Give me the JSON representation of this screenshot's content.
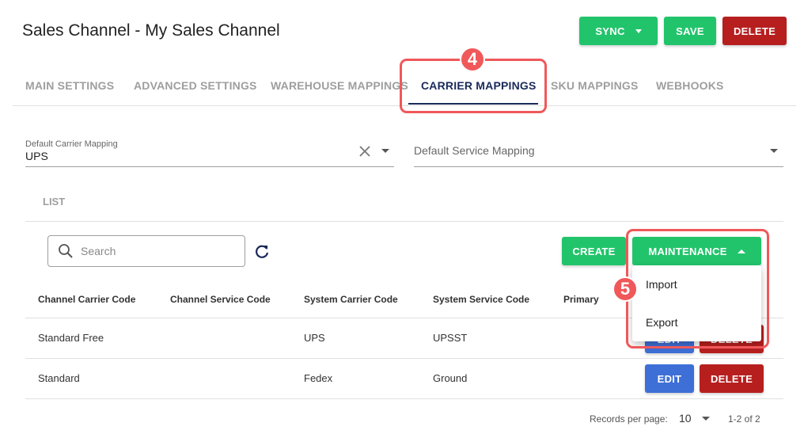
{
  "header": {
    "title": "Sales Channel - My Sales Channel",
    "sync_label": "SYNC",
    "save_label": "SAVE",
    "delete_label": "DELETE"
  },
  "tabs": [
    {
      "label": "MAIN SETTINGS"
    },
    {
      "label": "ADVANCED SETTINGS"
    },
    {
      "label": "WAREHOUSE MAPPINGS"
    },
    {
      "label": "CARRIER MAPPINGS",
      "active": true
    },
    {
      "label": "SKU MAPPINGS"
    },
    {
      "label": "WEBHOOKS"
    }
  ],
  "annotations": {
    "step_tab": "4",
    "step_menu": "5"
  },
  "default_carrier": {
    "label": "Default Carrier Mapping",
    "value": "UPS"
  },
  "default_service": {
    "placeholder": "Default Service Mapping"
  },
  "list": {
    "label": "LIST",
    "search_placeholder": "Search",
    "create_label": "CREATE",
    "maintenance_label": "MAINTENANCE",
    "menu": [
      "Import",
      "Export"
    ]
  },
  "table": {
    "columns": [
      "Channel Carrier Code",
      "Channel Service Code",
      "System Carrier Code",
      "System Service Code",
      "Primary"
    ],
    "rows": [
      {
        "channel_carrier": "Standard Free",
        "channel_service": "",
        "system_carrier": "UPS",
        "system_service": "UPSST",
        "primary": ""
      },
      {
        "channel_carrier": "Standard",
        "channel_service": "",
        "system_carrier": "Fedex",
        "system_service": "Ground",
        "primary": ""
      }
    ],
    "edit_label": "EDIT",
    "delete_label": "DELETE"
  },
  "footer": {
    "records_label": "Records per page:",
    "records_value": "10",
    "range": "1-2 of 2"
  },
  "colors": {
    "green": "#22c46b",
    "red": "#b71f1f",
    "blue": "#3d6fd6",
    "highlight": "#f0585a",
    "active_tab": "#1a2a5a"
  },
  "icons": [
    "close-icon",
    "chevron-down-icon",
    "search-icon",
    "refresh-icon",
    "chevron-up-icon"
  ]
}
